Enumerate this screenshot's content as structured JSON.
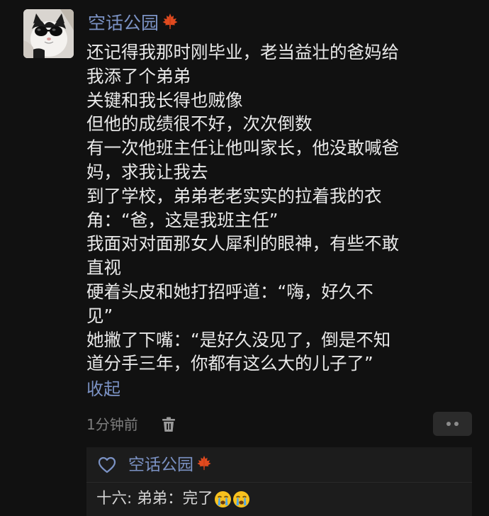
{
  "post": {
    "username": "空话公园",
    "username_icon": "maple-leaf-icon",
    "lines": [
      "还记得我那时刚毕业，老当益壮的爸妈给",
      "我添了个弟弟",
      "关键和我长得也贼像",
      "但他的成绩很不好，次次倒数",
      "有一次他班主任让他叫家长，他没敢喊爸",
      "妈，求我让我去",
      "到了学校，弟弟老老实实的拉着我的衣",
      "角：“爸，这是我班主任”",
      "我面对对面那女人犀利的眼神，有些不敢",
      "直视",
      "硬着头皮和她打招呼道：“嗨，好久不",
      "见”",
      "她撇了下嘴：“是好久没见了，倒是不知",
      "道分手三年，你都有这么大的儿子了”"
    ],
    "collapse_label": "收起",
    "time": "1分钟前"
  },
  "reply_section": {
    "liked_by": "空话公园",
    "reply_author": "十六:",
    "reply_text": "弟弟：完了",
    "reply_emojis": [
      "crying-face-icon",
      "crying-face-icon"
    ]
  },
  "colors": {
    "background": "#111111",
    "link_blue": "#7b92c4",
    "text": "#e9e9e9",
    "muted": "#7e7e7e",
    "reply_bg": "#1c1c1c",
    "maple": "#e04a1f"
  }
}
